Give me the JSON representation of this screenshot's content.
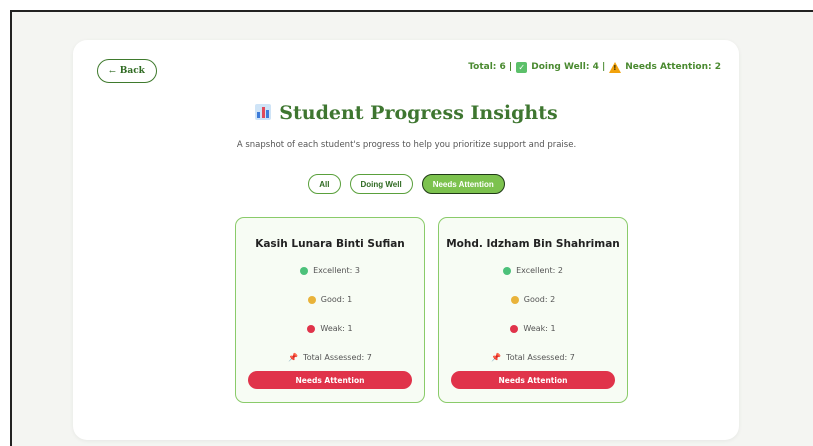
{
  "back": {
    "arrow": "←",
    "label": "Back"
  },
  "summary": {
    "total": "Total: 6 |",
    "doing_well": "Doing Well: 4 |",
    "needs_attention": "Needs Attention: 2"
  },
  "title": "Student Progress Insights",
  "subtitle": "A snapshot of each student's progress to help you prioritize support and praise.",
  "filters": {
    "all": "All",
    "doing_well": "Doing Well",
    "needs_attention": "Needs Attention",
    "active": "needs_attention"
  },
  "colors": {
    "excellent": "#4cc17a",
    "good": "#e9b33a",
    "weak": "#e0334a",
    "needs_attention": "#e0334a",
    "accent": "#3e7630"
  },
  "students": [
    {
      "name": "Kasih Lunara Binti Sufian",
      "excellent": "Excellent: 3",
      "good": "Good: 1",
      "weak": "Weak: 1",
      "total": "Total Assessed: 7",
      "status": "Needs Attention"
    },
    {
      "name": "Mohd. Idzham Bin Shahriman",
      "excellent": "Excellent: 2",
      "good": "Good: 2",
      "weak": "Weak: 1",
      "total": "Total Assessed: 7",
      "status": "Needs Attention"
    }
  ]
}
